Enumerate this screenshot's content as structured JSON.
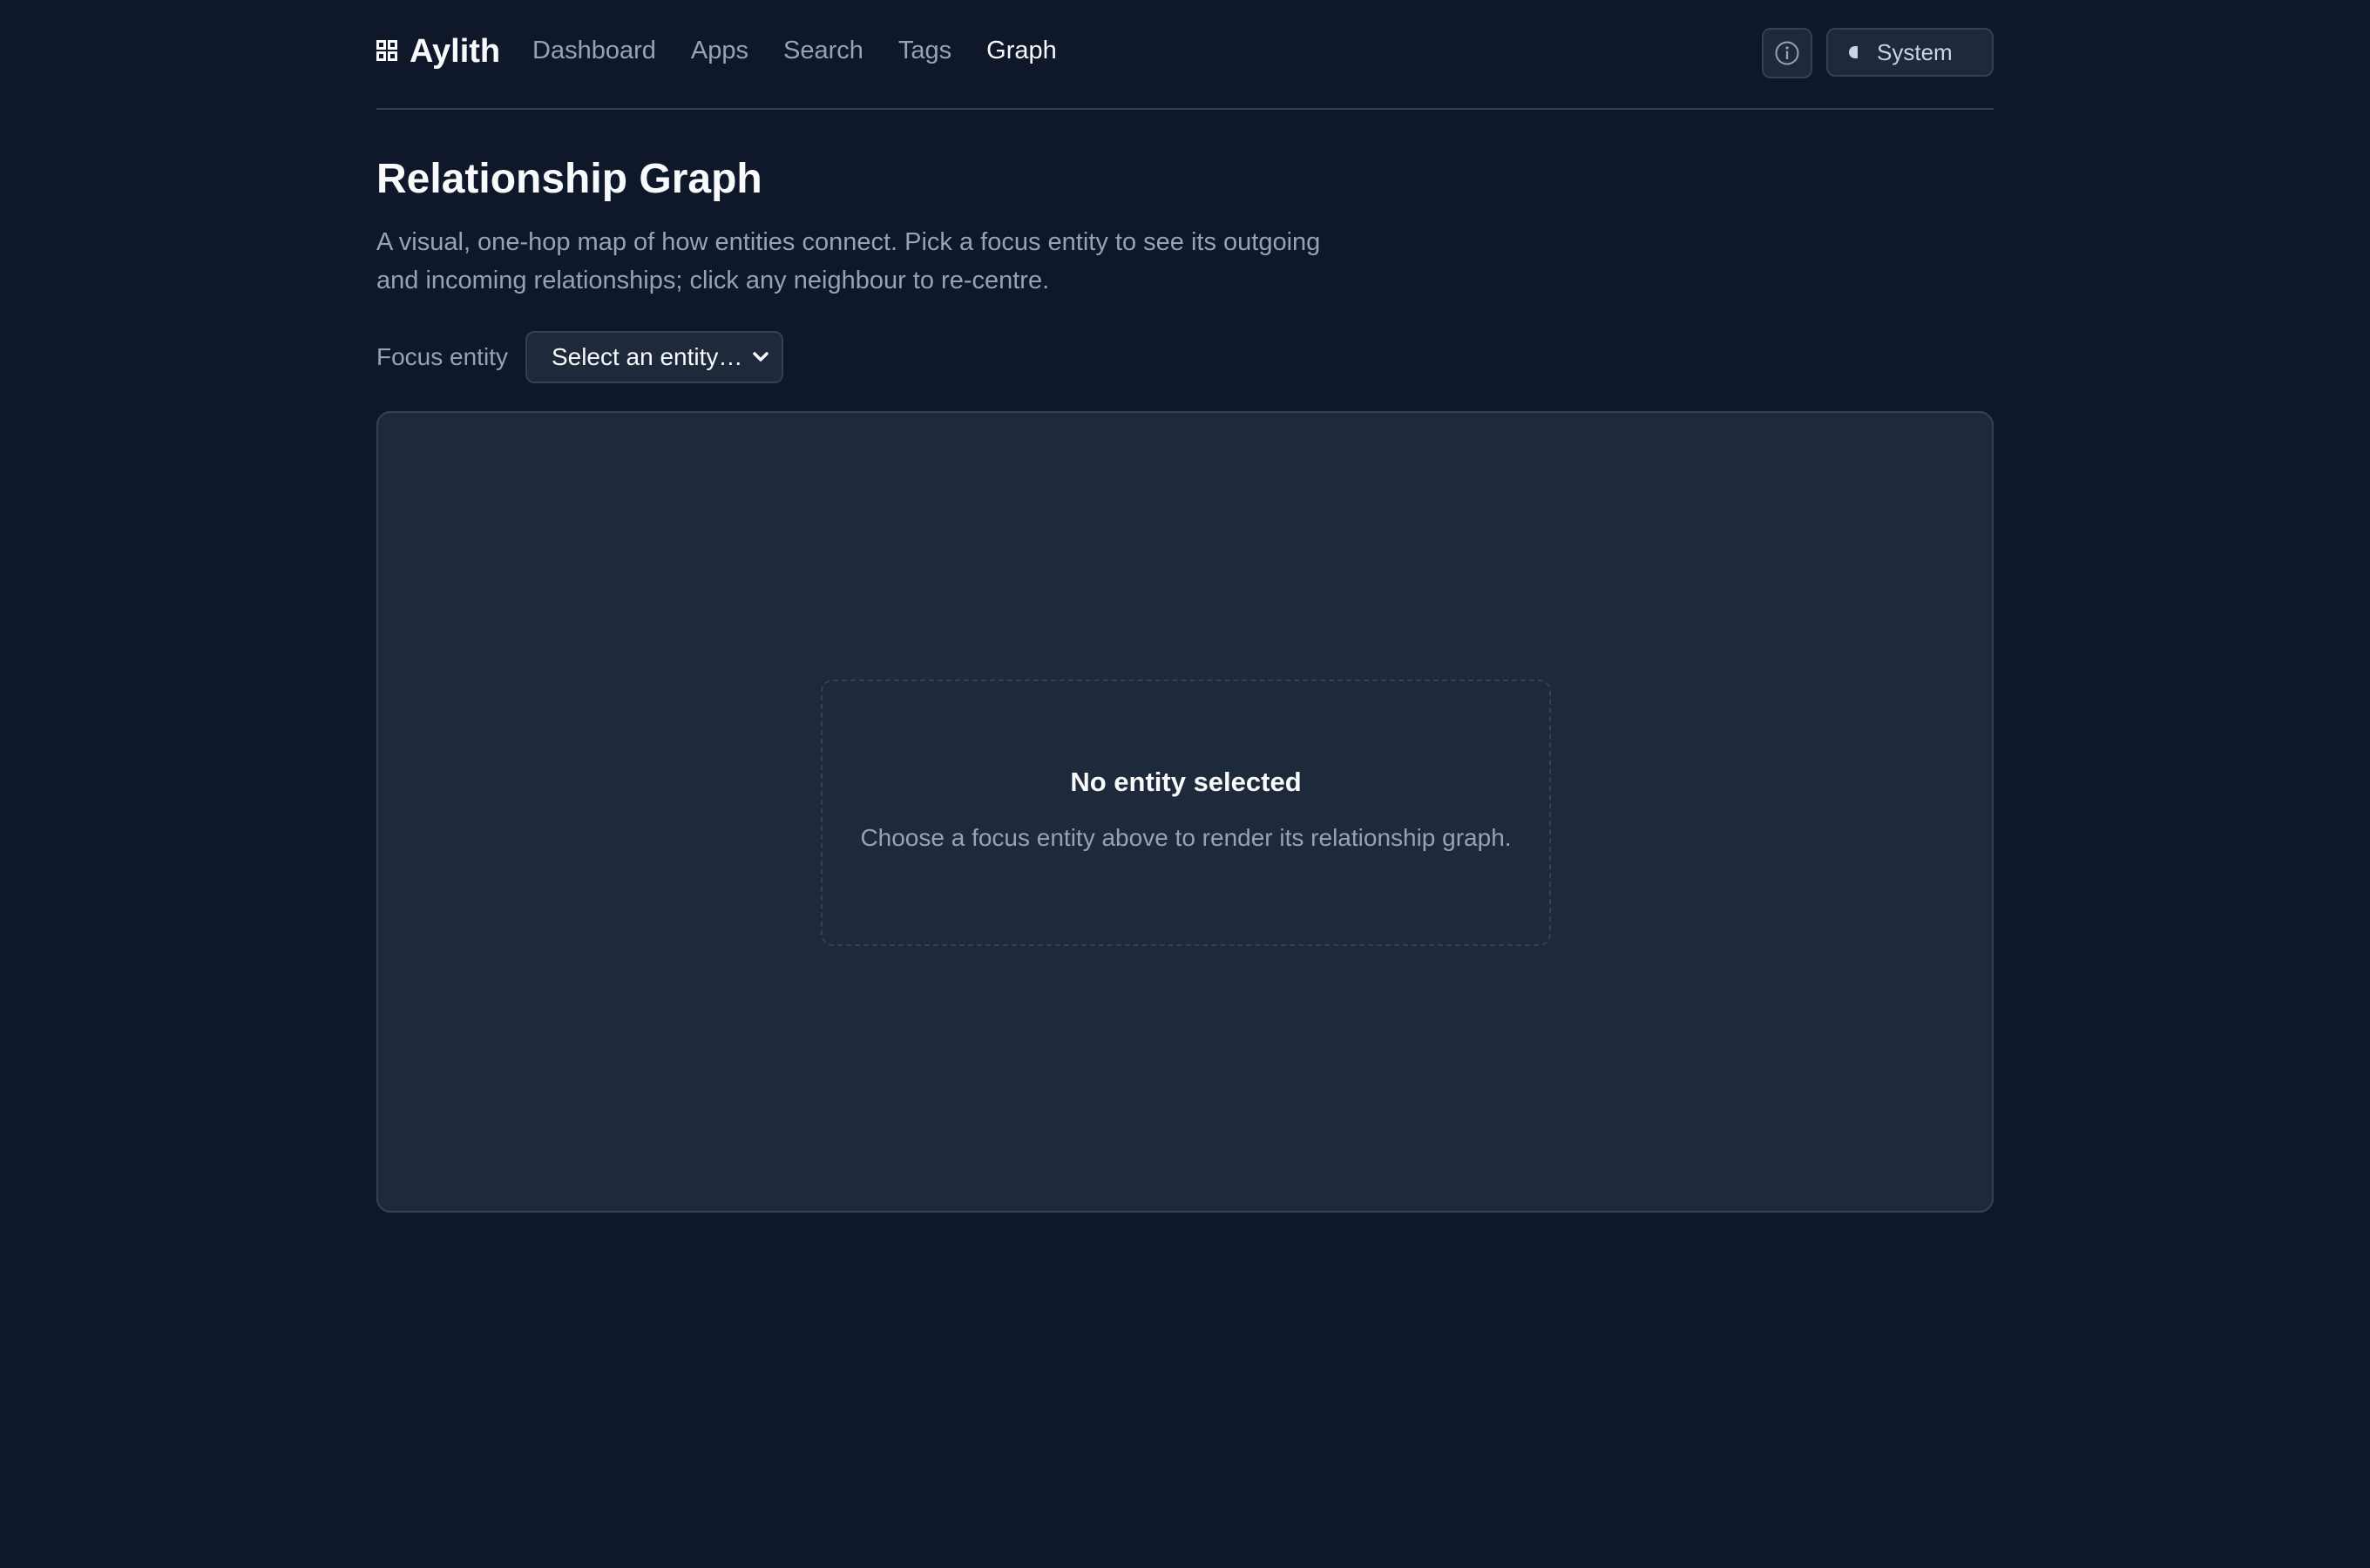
{
  "app": {
    "brand": "Aylith"
  },
  "nav": {
    "items": [
      {
        "label": "Dashboard",
        "active": false
      },
      {
        "label": "Apps",
        "active": false
      },
      {
        "label": "Search",
        "active": false
      },
      {
        "label": "Tags",
        "active": false
      },
      {
        "label": "Graph",
        "active": true
      }
    ]
  },
  "header": {
    "info_icon": "info-circle-icon",
    "theme": {
      "icon": "half-moon-icon",
      "label": "System"
    }
  },
  "page": {
    "title": "Relationship Graph",
    "description": "A visual, one-hop map of how entities connect. Pick a focus entity to see its outgoing and incoming relationships; click any neighbour to re-centre."
  },
  "focus": {
    "label": "Focus entity",
    "selected": "Select an entity…"
  },
  "graph": {
    "empty_title": "No entity selected",
    "empty_description": "Choose a focus entity above to render its relationship graph."
  },
  "colors": {
    "background": "#0f172a",
    "panel": "#1e293b",
    "border": "#334155",
    "text_primary": "#f8fafc",
    "text_muted": "#94a3b8"
  }
}
